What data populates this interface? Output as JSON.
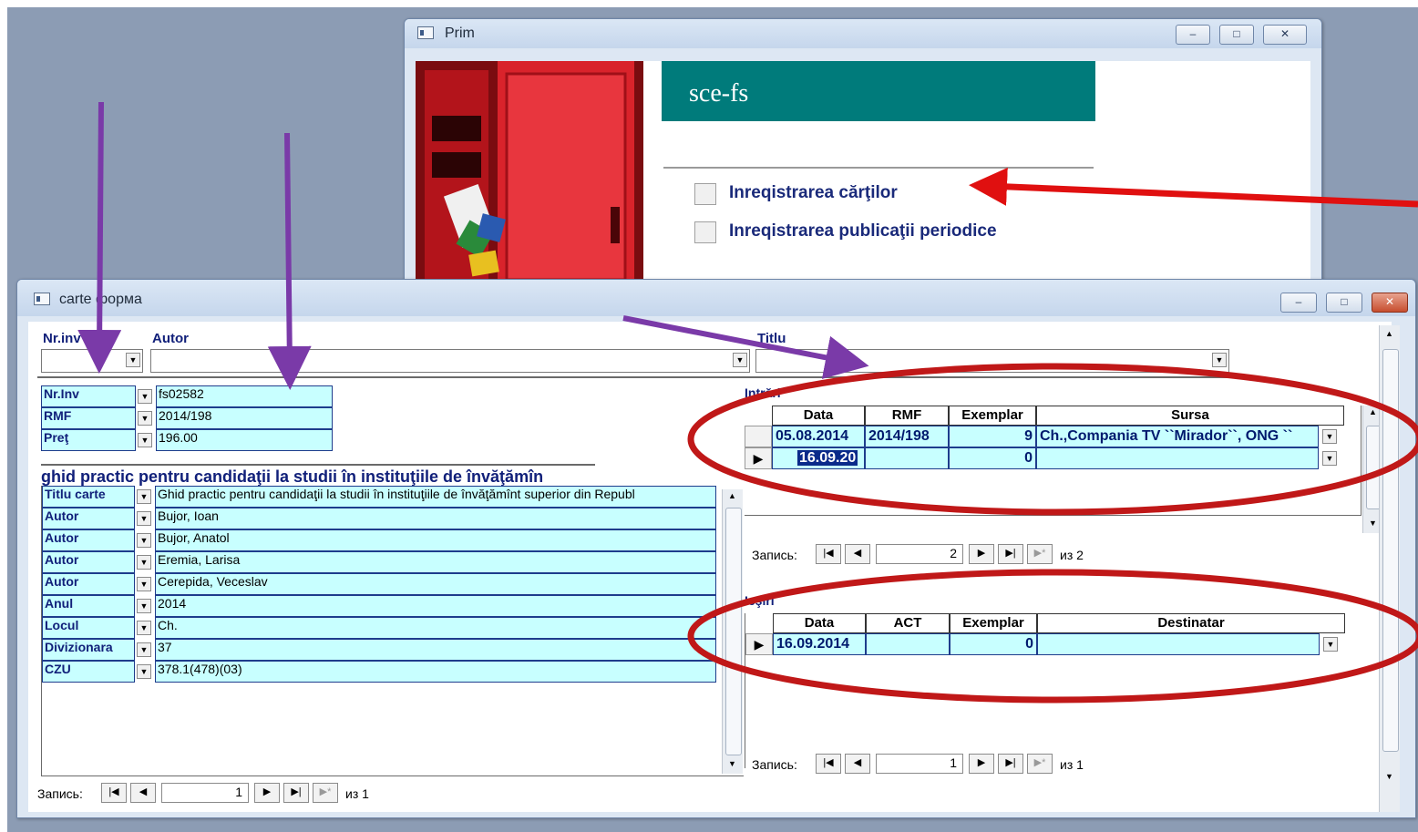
{
  "prim_window": {
    "title": "Prim",
    "banner_text": "sce-fs",
    "menu": [
      {
        "label": "Inreqistrarea cărţilor"
      },
      {
        "label": "Inreqistrarea publicaţii periodice"
      }
    ],
    "caption_buttons": {
      "minimize": "–",
      "maximize": "□",
      "close": "✕"
    }
  },
  "carte_window": {
    "title": "carte форма",
    "filter": {
      "nrinv_label": "Nr.inv",
      "autor_label": "Autor",
      "titlu_label": "Titlu",
      "nrinv_value": "",
      "autor_value": "",
      "titlu_value": ""
    },
    "info": [
      {
        "label": "Nr.Inv",
        "value": "fs02582"
      },
      {
        "label": "RMF",
        "value": "2014/198"
      },
      {
        "label": "Preţ",
        "value": "196.00"
      }
    ],
    "heading": "ghid practic pentru candidaţii la studii în instituţiile de învăţămîn",
    "details": [
      {
        "label": "Titlu carte",
        "value": "Ghid practic pentru candidaţii la studii în instituţiile de învăţămînt superior din Republ"
      },
      {
        "label": "Autor",
        "value": "Bujor, Ioan"
      },
      {
        "label": "Autor",
        "value": "Bujor, Anatol"
      },
      {
        "label": "Autor",
        "value": "Eremia, Larisa"
      },
      {
        "label": "Autor",
        "value": "Cerepida, Veceslav"
      },
      {
        "label": "Anul",
        "value": "2014"
      },
      {
        "label": "Locul",
        "value": "Ch."
      },
      {
        "label": "Divizionara",
        "value": "37"
      },
      {
        "label": "CZU",
        "value": "378.1(478)(03)"
      }
    ],
    "intrari": {
      "title": "Intrări",
      "columns": [
        "Data",
        "RMF",
        "Exemplar",
        "Sursa"
      ],
      "rows": [
        {
          "data": "05.08.2014",
          "rmf": "2014/198",
          "exemplar": "9",
          "sursa": "Ch.,Compania TV ``Mirador``, ONG ``"
        },
        {
          "data": "16.09.20",
          "rmf": "",
          "exemplar": "0",
          "sursa": ""
        }
      ],
      "nav": {
        "label": "Запись:",
        "current": "2",
        "total_label": "из 2"
      }
    },
    "iesiri": {
      "title": "Ieşiri",
      "columns": [
        "Data",
        "ACT",
        "Exemplar",
        "Destinatar"
      ],
      "rows": [
        {
          "data": "16.09.2014",
          "act": "",
          "exemplar": "0",
          "destinatar": ""
        }
      ],
      "nav": {
        "label": "Запись:",
        "current": "1",
        "total_label": "из 1"
      }
    },
    "main_nav": {
      "label": "Запись:",
      "current": "1",
      "total_label": "из 1"
    },
    "caption_buttons": {
      "minimize": "–",
      "maximize": "□",
      "close": "✕"
    }
  },
  "colors": {
    "field_bg": "#c8ffff",
    "label_color": "#11207a",
    "banner_teal": "#007b7b",
    "annotation_red": "#c01818",
    "annotation_purple": "#7a3aa8"
  }
}
